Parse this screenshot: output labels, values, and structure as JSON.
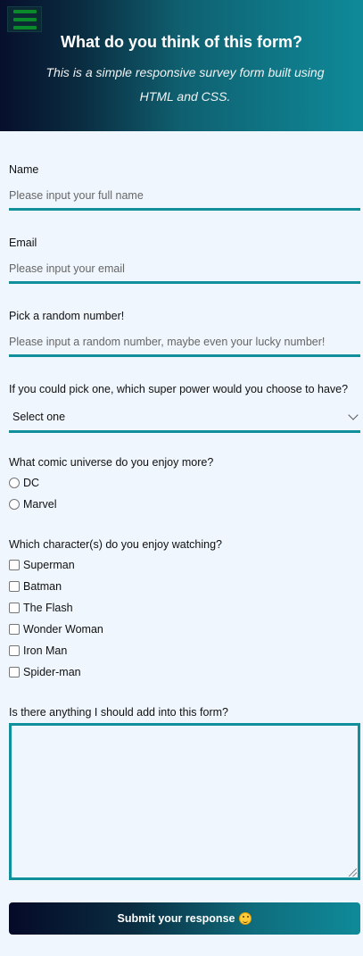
{
  "header": {
    "title": "What do you think of this form?",
    "subtitle": "This is a simple responsive survey form built using HTML and CSS.",
    "menu_icon": "hamburger-menu-icon"
  },
  "form": {
    "name": {
      "label": "Name",
      "placeholder": "Please input your full name",
      "value": ""
    },
    "email": {
      "label": "Email",
      "placeholder": "Please input your email",
      "value": ""
    },
    "number": {
      "label": "Pick a random number!",
      "placeholder": "Please input a random number, maybe even your lucky number!",
      "value": ""
    },
    "superpower": {
      "label": "If you could pick one, which super power would you choose to have?",
      "selected": "Select one"
    },
    "universe": {
      "label": "What comic universe do you enjoy more?",
      "options": [
        "DC",
        "Marvel"
      ]
    },
    "characters": {
      "label": "Which character(s) do you enjoy watching?",
      "options": [
        "Superman",
        "Batman",
        "The Flash",
        "Wonder Woman",
        "Iron Man",
        "Spider-man"
      ]
    },
    "comments": {
      "label": "Is there anything I should add into this form?",
      "value": ""
    },
    "submit": {
      "label": "Submit your response",
      "icon": "smiley-emoji-icon"
    }
  },
  "colors": {
    "accent": "#118f9b",
    "background": "#eff6fd",
    "header_dark": "#070f2c",
    "header_light": "#0f8a99"
  }
}
